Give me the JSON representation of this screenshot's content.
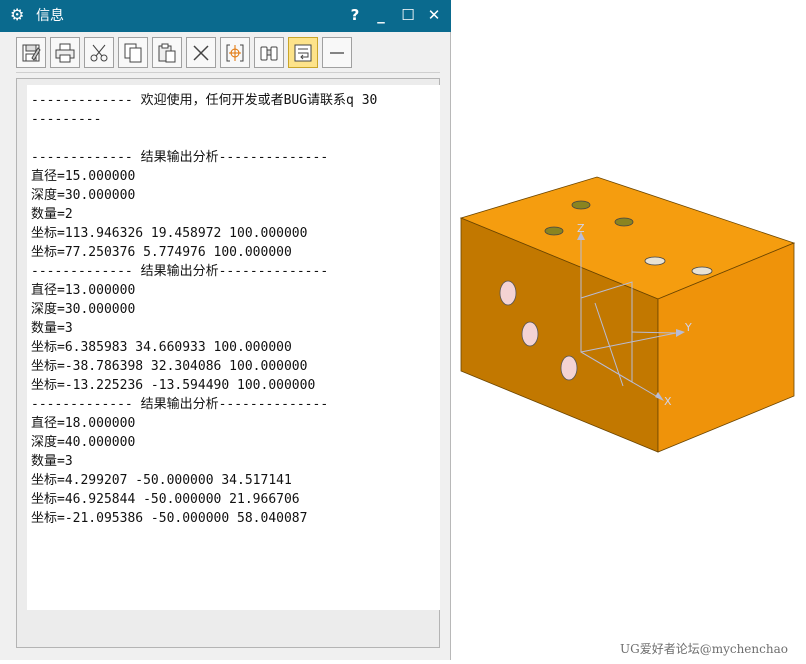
{
  "window": {
    "title": "信息",
    "controls": {
      "help": "?",
      "minimize": "_",
      "maximize": "☐",
      "close": "✕"
    }
  },
  "toolbar": {
    "buttons": [
      {
        "icon": "save-icon"
      },
      {
        "icon": "print-icon"
      },
      {
        "icon": "cut-icon"
      },
      {
        "icon": "copy-icon"
      },
      {
        "icon": "paste-icon"
      },
      {
        "icon": "delete-icon"
      },
      {
        "icon": "crosshair-icon"
      },
      {
        "icon": "binoculars-icon"
      },
      {
        "icon": "word-wrap-icon",
        "active": true
      },
      {
        "icon": "collapse-icon"
      }
    ],
    "active_color": "#fde38a"
  },
  "info": {
    "lines": [
      "------------- 欢迎使用，任何开发或者BUG请联系q 30",
      "---------",
      "",
      "------------- 结果输出分析--------------",
      "直径=15.000000",
      "深度=30.000000",
      "数量=2",
      "坐标=113.946326 19.458972 100.000000",
      "坐标=77.250376 5.774976 100.000000",
      "------------- 结果输出分析--------------",
      "直径=13.000000",
      "深度=30.000000",
      "数量=3",
      "坐标=6.385983 34.660933 100.000000",
      "坐标=-38.786398 32.304086 100.000000",
      "坐标=-13.225236 -13.594490 100.000000",
      "------------- 结果输出分析--------------",
      "直径=18.000000",
      "深度=40.000000",
      "数量=3",
      "坐标=4.299207 -50.000000 34.517141",
      "坐标=46.925844 -50.000000 21.966706",
      "坐标=-21.095386 -50.000000 58.040087"
    ]
  },
  "viewport": {
    "axes": {
      "x": "X",
      "y": "Y",
      "z": "Z"
    },
    "colors": {
      "top": "#f59d0f",
      "front": "#c27800",
      "right": "#ef930a",
      "axis": "#b8bcd6"
    }
  },
  "watermark": "UG爱好者论坛@mychenchao"
}
